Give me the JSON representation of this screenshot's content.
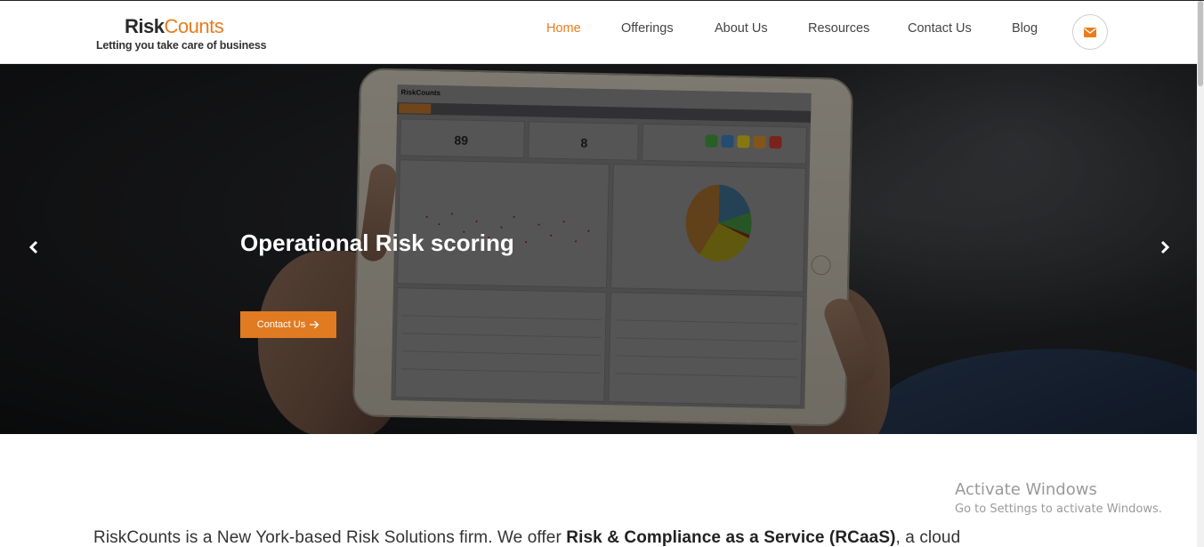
{
  "header": {
    "logo": {
      "brand_risk": "Risk",
      "brand_counts": "Counts",
      "tagline": "Letting you take care of business"
    },
    "nav": [
      {
        "label": "Home",
        "active": true
      },
      {
        "label": "Offerings",
        "active": false
      },
      {
        "label": "About Us",
        "active": false
      },
      {
        "label": "Resources",
        "active": false
      },
      {
        "label": "Contact Us",
        "active": false
      },
      {
        "label": "Blog",
        "active": false
      }
    ],
    "mail_icon": "envelope-icon"
  },
  "hero": {
    "title": "Operational Risk scoring",
    "cta_label": "Contact Us",
    "cta_icon": "arrow-right-icon",
    "prev_icon": "chevron-left-icon",
    "next_icon": "chevron-right-icon",
    "tablet_screen": {
      "logo": "RiskCounts",
      "kpi_1": "89",
      "kpi_2": "8",
      "grades": [
        "A",
        "B",
        "C",
        "D",
        "F"
      ],
      "grade_counts": [
        "10",
        "19",
        "34",
        "25",
        "1"
      ]
    }
  },
  "intro": {
    "text_start": "RiskCounts is a New York-based Risk Solutions firm. We offer ",
    "text_bold": "Risk & Compliance as a Service (RCaaS)",
    "text_end": ", a cloud"
  },
  "watermark": {
    "title": "Activate Windows",
    "subtitle": "Go to Settings to activate Windows."
  },
  "colors": {
    "accent": "#e87c1e",
    "cta_bg": "#e07b22",
    "nav_text": "#444444",
    "grade_A": "#3f9a3c",
    "grade_B": "#3a7ab8",
    "grade_C": "#d8c21a",
    "grade_D": "#d58a2a",
    "grade_F": "#c43a2a"
  }
}
